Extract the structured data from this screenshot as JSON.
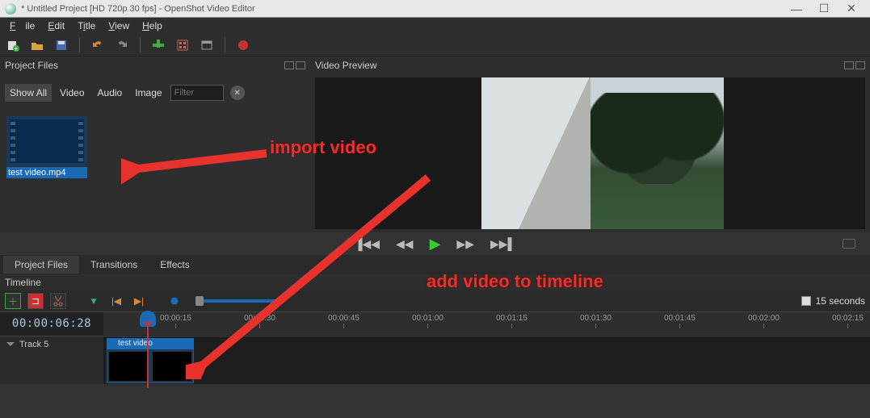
{
  "window": {
    "title": "* Untitled Project [HD 720p 30 fps] - OpenShot Video Editor",
    "min": "—",
    "max": "☐",
    "close": "✕"
  },
  "menu": {
    "file": "File",
    "edit": "Edit",
    "title": "Title",
    "view": "View",
    "help": "Help"
  },
  "panels": {
    "project_files": "Project Files",
    "video_preview": "Video Preview",
    "timeline": "Timeline"
  },
  "filter": {
    "show_all": "Show All",
    "video": "Video",
    "audio": "Audio",
    "image": "Image",
    "placeholder": "Filter",
    "close": "✕"
  },
  "thumb": {
    "label": "test video.mp4"
  },
  "tabs": {
    "pf": "Project Files",
    "tr": "Transitions",
    "ef": "Effects"
  },
  "zoom_label": "15 seconds",
  "timecode": "00:00:06:28",
  "ticks": [
    "00:00:15",
    "00:00:30",
    "00:00:45",
    "00:01:00",
    "00:01:15",
    "00:01:30",
    "00:01:45",
    "00:02:00",
    "00:02:15"
  ],
  "track": {
    "name": "Track 5",
    "clip": "test video"
  },
  "annot": {
    "import": "import  video",
    "add": "add video to timeline"
  }
}
